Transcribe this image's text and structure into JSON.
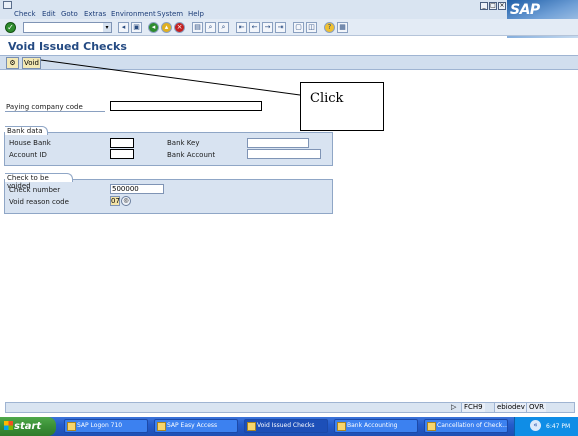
{
  "menu": {
    "items": [
      "Check",
      "Edit",
      "Goto",
      "Extras",
      "Environment",
      "System",
      "Help"
    ],
    "logo_text": "SAP"
  },
  "toolbar": {
    "command_value": "",
    "icons": [
      "back-icon",
      "save-icon",
      "green-back-icon",
      "exit-icon",
      "cancel-icon",
      "print-icon",
      "find-icon",
      "find-next-icon",
      "first-page-icon",
      "prev-page-icon",
      "next-page-icon",
      "last-page-icon",
      "new-session-icon",
      "shortcut-icon",
      "help-icon",
      "layout-icon"
    ]
  },
  "page": {
    "title": "Void Issued Checks"
  },
  "app_toolbar": {
    "void_label": "Void"
  },
  "callout": {
    "text": "Click"
  },
  "fields": {
    "paying_company_code": {
      "label": "Paying company code",
      "value": ""
    }
  },
  "bank_data": {
    "title": "Bank data",
    "house_bank": {
      "label": "House Bank",
      "value": ""
    },
    "account_id": {
      "label": "Account ID",
      "value": ""
    },
    "bank_key": {
      "label": "Bank Key",
      "value": ""
    },
    "bank_account": {
      "label": "Bank Account",
      "value": ""
    }
  },
  "check_void": {
    "title": "Check to be voided",
    "check_number": {
      "label": "Check number",
      "value": "500000"
    },
    "void_reason_code": {
      "label": "Void reason code",
      "value": "07"
    }
  },
  "statusbar": {
    "transaction": "FCH9",
    "server": "ebiodev",
    "mode": "OVR"
  },
  "taskbar": {
    "start_label": "start",
    "tasks": [
      "SAP Logon 710",
      "SAP Easy Access",
      "Void Issued Checks",
      "Bank Accounting",
      "Cancellation of Check..."
    ],
    "clock": "6:47 PM"
  },
  "colors": {
    "title": "#244a82",
    "taskbar": "#245ccc",
    "start_button": "#3a8f36",
    "groupbox": "#d8e3f1"
  }
}
